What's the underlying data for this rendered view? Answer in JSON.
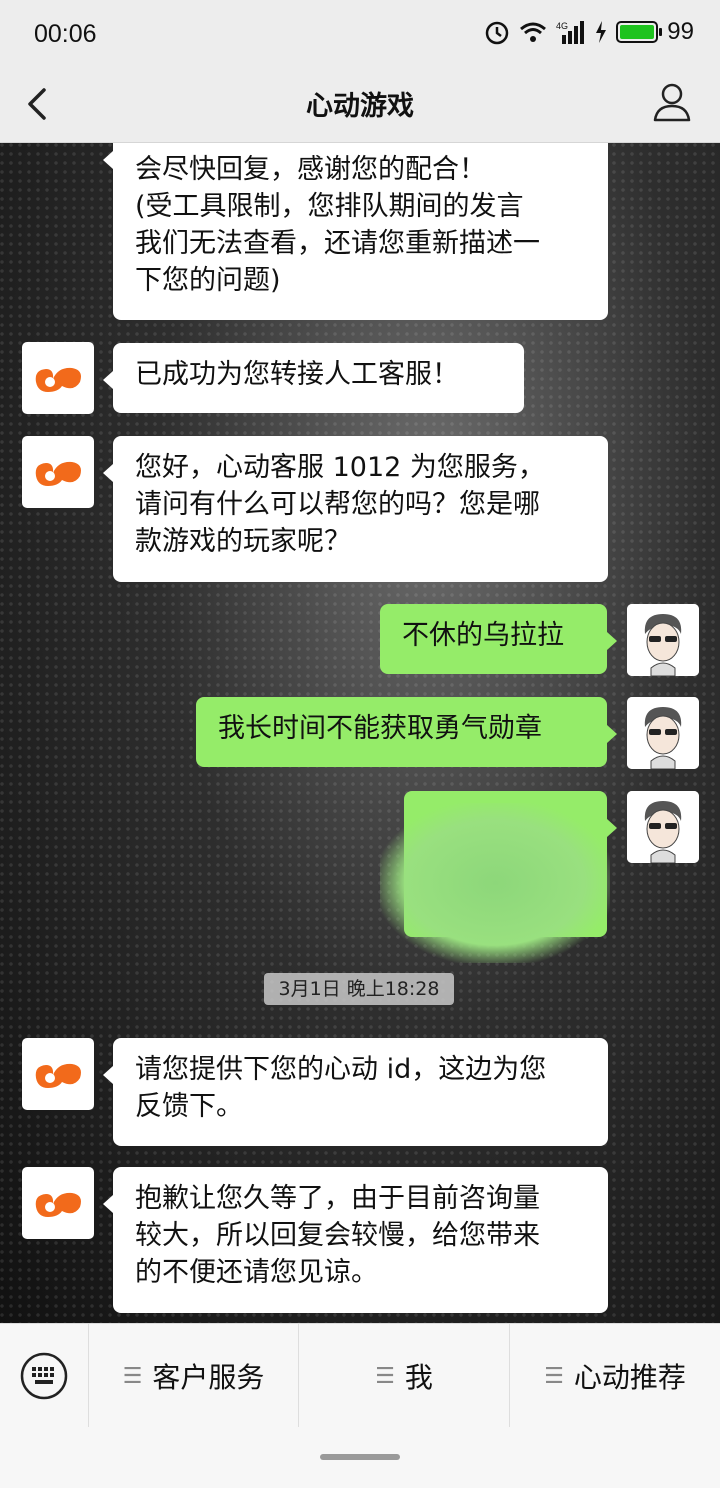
{
  "status_bar": {
    "time": "00:06",
    "battery": "99"
  },
  "header": {
    "title": "心动游戏"
  },
  "messages": [
    {
      "from": "service",
      "lines": [
        "会尽快回复，感谢您的配合！",
        "(受工具限制，您排队期间的发言",
        "我们无法查看，还请您重新描述一",
        "下您的问题)"
      ]
    },
    {
      "from": "service",
      "lines": [
        "已成功为您转接人工客服！"
      ]
    },
    {
      "from": "service",
      "lines": [
        "您好，心动客服 1012 为您服务，",
        "请问有什么可以帮您的吗？您是哪",
        "款游戏的玩家呢？"
      ]
    },
    {
      "from": "me",
      "lines": [
        "不休的乌拉拉"
      ]
    },
    {
      "from": "me",
      "lines": [
        "我长时间不能获取勇气勋章"
      ]
    },
    {
      "from": "me",
      "lines": [
        ""
      ]
    },
    {
      "from": "service",
      "lines": [
        "请您提供下您的心动 id，这边为您",
        "反馈下。"
      ]
    },
    {
      "from": "service",
      "lines": [
        "抱歉让您久等了，由于目前咨询量",
        "较大，所以回复会较慢，给您带来",
        "的不便还请您见谅。"
      ]
    }
  ],
  "timestamp": "3月1日 晚上18:28",
  "bottom_menu": {
    "items": [
      "客户服务",
      "我",
      "心动推荐"
    ]
  },
  "colors": {
    "bubble_me": "#95ec69",
    "brand_orange": "#f26a1b"
  },
  "icons": [
    "back-icon",
    "user-profile-icon",
    "keyboard-icon",
    "brand-logo-icon",
    "user-avatar"
  ]
}
